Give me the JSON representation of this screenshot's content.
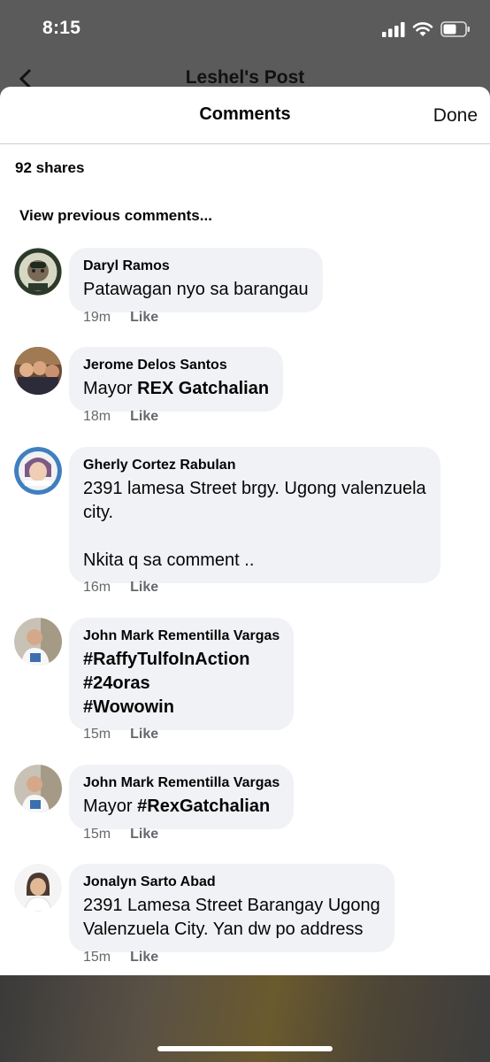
{
  "status": {
    "time": "8:15"
  },
  "background": {
    "header_title": "Leshel's Post"
  },
  "sheet": {
    "title": "Comments",
    "done_label": "Done"
  },
  "shares_text": "92 shares",
  "view_previous": "View previous comments...",
  "comments": [
    {
      "author": "Daryl Ramos",
      "lines": [
        "Patawagan nyo sa barangau"
      ],
      "time": "19m",
      "like": "Like"
    },
    {
      "author": "Jerome Delos Santos",
      "prefix": "Mayor ",
      "bold": "REX Gatchalian",
      "time": "18m",
      "like": "Like"
    },
    {
      "author": "Gherly Cortez Rabulan",
      "lines": [
        "2391 lamesa Street brgy. Ugong valenzuela",
        "city.",
        "",
        "Nkita q sa comment .."
      ],
      "time": "16m",
      "like": "Like"
    },
    {
      "author": "John Mark Rementilla Vargas",
      "lines": [
        "#RaffyTulfoInAction",
        "#24oras",
        "#Wowowin"
      ],
      "time": "15m",
      "like": "Like"
    },
    {
      "author": "John Mark Rementilla Vargas",
      "prefix": "Mayor ",
      "bold": "#RexGatchalian",
      "time": "15m",
      "like": "Like"
    },
    {
      "author": "Jonalyn Sarto Abad",
      "lines": [
        "2391 Lamesa Street Barangay Ugong",
        "Valenzuela City. Yan dw po address"
      ],
      "time": "15m",
      "like": "Like"
    }
  ],
  "colors": {
    "bubble": "#f0f2f5",
    "meta": "#65676b",
    "text": "#050505"
  }
}
